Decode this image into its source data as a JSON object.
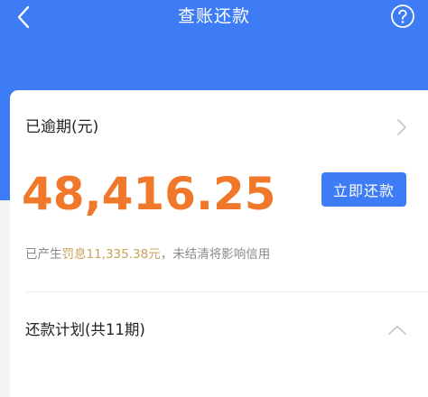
{
  "navbar": {
    "title": "查账还款"
  },
  "overdue": {
    "label": "已逾期(元)",
    "amount": "48,416.25",
    "repay_label": "立即还款"
  },
  "penalty": {
    "prefix": "已产生",
    "highlight": "罚息11,335.38元",
    "suffix": "，未结清将影响信用"
  },
  "plan": {
    "label": "还款计划(共11期)"
  },
  "colors": {
    "brand_blue": "#3d7cf5",
    "amount_orange": "#f0782b",
    "penalty_gold": "#c9a15a"
  },
  "icons": {
    "back": "chevron-left-icon",
    "help": "question-circle-icon",
    "detail": "chevron-right-icon",
    "collapse": "chevron-up-icon"
  }
}
